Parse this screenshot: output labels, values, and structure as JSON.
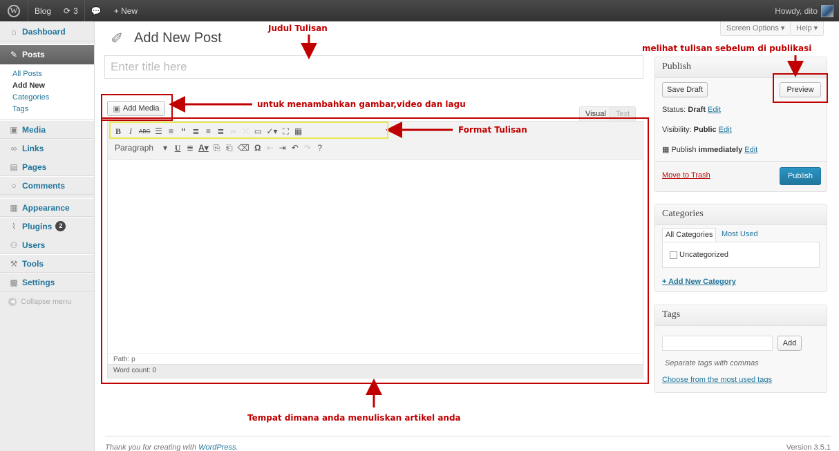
{
  "adminbar": {
    "site": "Blog",
    "updates": "3",
    "new_label": "+ New",
    "howdy": "Howdy, dito"
  },
  "sidebar": {
    "dashboard": "Dashboard",
    "posts": "Posts",
    "posts_sub": [
      "All Posts",
      "Add New",
      "Categories",
      "Tags"
    ],
    "media": "Media",
    "links": "Links",
    "pages": "Pages",
    "comments": "Comments",
    "appearance": "Appearance",
    "plugins": "Plugins",
    "plugins_badge": "2",
    "users": "Users",
    "tools": "Tools",
    "settings": "Settings",
    "collapse": "Collapse menu"
  },
  "header": {
    "title": "Add New Post",
    "screen_options": "Screen Options ▾",
    "help": "Help ▾"
  },
  "editor": {
    "title_placeholder": "Enter title here",
    "add_media": "Add Media",
    "tab_visual": "Visual",
    "tab_text": "Text",
    "format_select": "Paragraph",
    "path": "Path: p",
    "word_count": "Word count: 0"
  },
  "publish": {
    "heading": "Publish",
    "save_draft": "Save Draft",
    "preview": "Preview",
    "status_label": "Status:",
    "status_value": "Draft",
    "visibility_label": "Visibility:",
    "visibility_value": "Public",
    "schedule_label": "Publish",
    "schedule_value": "immediately",
    "edit": "Edit",
    "trash": "Move to Trash",
    "publish_button": "Publish"
  },
  "categories": {
    "heading": "Categories",
    "tab_all": "All Categories",
    "tab_most": "Most Used",
    "item": "Uncategorized",
    "add_new": "+ Add New Category"
  },
  "tags": {
    "heading": "Tags",
    "add_button": "Add",
    "hint": "Separate tags with commas",
    "choose": "Choose from the most used tags"
  },
  "footer": {
    "thanks_prefix": "Thank you for creating with",
    "wp_link": "WordPress",
    "thanks_suffix": ".",
    "version": "Version 3.5.1"
  },
  "annotations": {
    "title": "Judul Tulisan",
    "preview": "melihat tulisan sebelum di publikasi",
    "media": "untuk menambahkan gambar,video dan lagu",
    "format": "Format Tulisan",
    "body": "Tempat dimana anda menuliskan artikel anda"
  }
}
